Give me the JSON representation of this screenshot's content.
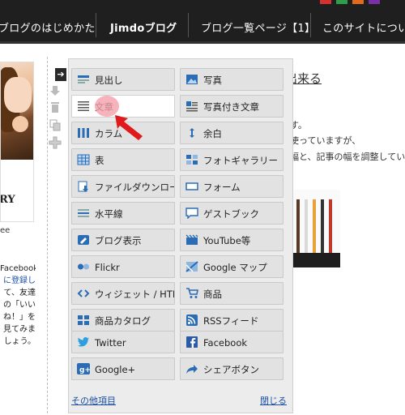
{
  "nav": {
    "items": [
      "ブログのはじめかた",
      "Jimdoブログ",
      "ブログ一覧ページ【1】",
      "このサイトについて"
    ]
  },
  "colors": {
    "accent_stripes": [
      "#d8302f",
      "#2f9e4a",
      "#e36a1c",
      "#7a2fa8"
    ],
    "link": "#1a4fa3",
    "highlight": "#f4a0ab",
    "arrow_red": "#e0191c"
  },
  "left": {
    "title": "RY",
    "ee": "ee",
    "para": [
      "Facebook",
      "に登録し",
      "て、友達",
      "の「いい",
      "ね！」を",
      "見てみま",
      "しょう。"
    ]
  },
  "right": {
    "title": "出来る",
    "lines": [
      "す。",
      "使っていますが、",
      "幅と、記事の幅を調整してい"
    ]
  },
  "panel": {
    "items_left": [
      {
        "label": "見出し",
        "icon": "heading-icon"
      },
      {
        "label": "文章",
        "icon": "text-icon",
        "active": true
      },
      {
        "label": "カラム",
        "icon": "columns-icon"
      },
      {
        "label": "表",
        "icon": "table-icon"
      },
      {
        "label": "ファイルダウンロード",
        "icon": "download-icon"
      },
      {
        "label": "水平線",
        "icon": "horizontal-line-icon"
      },
      {
        "label": "ブログ表示",
        "icon": "blog-icon"
      },
      {
        "label": "Flickr",
        "icon": "flickr-icon"
      },
      {
        "label": "ウィジェット / HTML",
        "icon": "code-icon"
      },
      {
        "label": "商品カタログ",
        "icon": "catalog-icon"
      },
      {
        "label": "Twitter",
        "icon": "twitter-icon"
      },
      {
        "label": "Google+",
        "icon": "googleplus-icon"
      }
    ],
    "items_right": [
      {
        "label": "写真",
        "icon": "photo-icon"
      },
      {
        "label": "写真付き文章",
        "icon": "photo-text-icon"
      },
      {
        "label": "余白",
        "icon": "spacer-icon"
      },
      {
        "label": "フォトギャラリー",
        "icon": "gallery-icon"
      },
      {
        "label": "フォーム",
        "icon": "form-icon"
      },
      {
        "label": "ゲストブック",
        "icon": "guestbook-icon"
      },
      {
        "label": "YouTube等",
        "icon": "video-icon"
      },
      {
        "label": "Google マップ",
        "icon": "map-icon"
      },
      {
        "label": "商品",
        "icon": "cart-icon"
      },
      {
        "label": "RSSフィード",
        "icon": "rss-icon"
      },
      {
        "label": "Facebook",
        "icon": "facebook-icon"
      },
      {
        "label": "シェアボタン",
        "icon": "share-icon"
      }
    ],
    "more_label": "その他項目",
    "close_label": "閉じる"
  }
}
